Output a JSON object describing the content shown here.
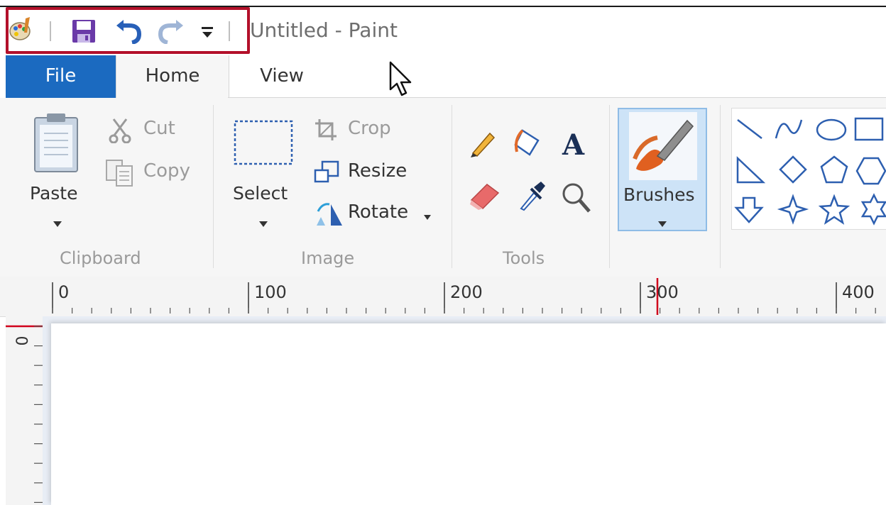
{
  "window": {
    "title": "Untitled - Paint"
  },
  "quick_access_toolbar": {
    "items": [
      "paint-app-icon",
      "save-icon",
      "undo-icon",
      "redo-icon",
      "customize-dropdown-icon"
    ]
  },
  "tabs": [
    {
      "label": "File",
      "active": false,
      "accent": "#1b6ac0"
    },
    {
      "label": "Home",
      "active": true
    },
    {
      "label": "View",
      "active": false
    }
  ],
  "ribbon": {
    "clipboard": {
      "label": "Clipboard",
      "paste": "Paste",
      "cut": "Cut",
      "copy": "Copy"
    },
    "image": {
      "label": "Image",
      "select": "Select",
      "crop": "Crop",
      "resize": "Resize",
      "rotate": "Rotate"
    },
    "tools": {
      "label": "Tools",
      "items": [
        "pencil-icon",
        "fill-icon",
        "text-icon",
        "eraser-icon",
        "color-picker-icon",
        "magnifier-icon"
      ],
      "text_glyph": "A"
    },
    "brushes": {
      "label": "Brushes"
    },
    "shapes": {
      "items": [
        "line",
        "curve",
        "oval",
        "rectangle",
        "triangle",
        "diamond",
        "pentagon",
        "hexagon",
        "arrow-down",
        "four-point-star",
        "five-point-star",
        "six-point-star"
      ]
    }
  },
  "ruler": {
    "horizontal_labels": [
      "0",
      "100",
      "200",
      "300",
      "400"
    ],
    "vertical_labels": [
      "0"
    ],
    "marker_color": "#d0021b"
  },
  "colors": {
    "highlight_border": "#b3102a",
    "file_tab": "#1b6ac0",
    "brushes_active": "#cde3f7"
  }
}
